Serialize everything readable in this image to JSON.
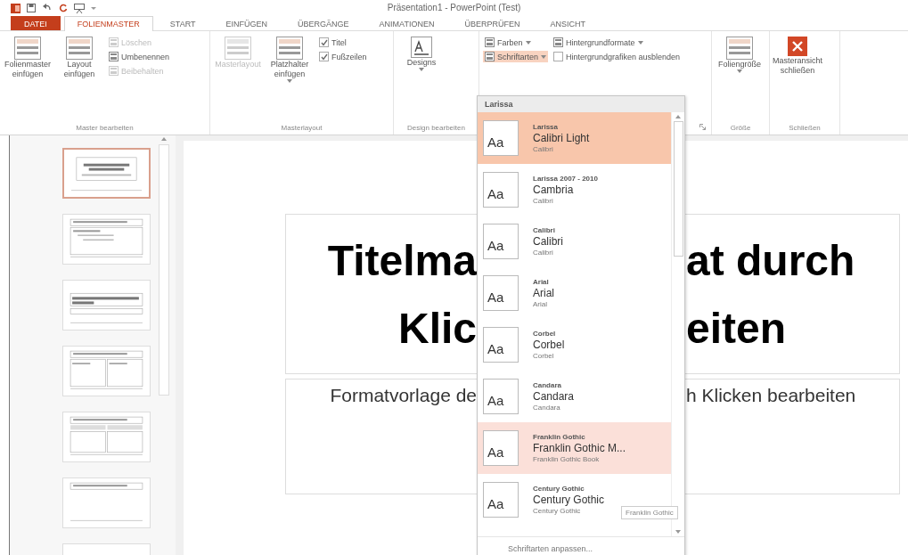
{
  "window": {
    "title": "Präsentation1 - PowerPoint (Test)"
  },
  "tabs": [
    {
      "label": "DATEI",
      "kind": "file",
      "selected": false
    },
    {
      "label": "FOLIENMASTER",
      "kind": "tab",
      "selected": true
    },
    {
      "label": "START",
      "kind": "tab",
      "selected": false
    },
    {
      "label": "EINFÜGEN",
      "kind": "tab",
      "selected": false
    },
    {
      "label": "ÜBERGÄNGE",
      "kind": "tab",
      "selected": false
    },
    {
      "label": "ANIMATIONEN",
      "kind": "tab",
      "selected": false
    },
    {
      "label": "ÜBERPRÜFEN",
      "kind": "tab",
      "selected": false
    },
    {
      "label": "ANSICHT",
      "kind": "tab",
      "selected": false
    }
  ],
  "ribbon": {
    "groups": [
      {
        "label": "Master bearbeiten",
        "items": [
          {
            "kind": "large",
            "label": "Folienmaster einfügen",
            "disabled": false,
            "dropdown": false
          },
          {
            "kind": "large",
            "label": "Layout einfügen",
            "disabled": false,
            "dropdown": false
          },
          {
            "kind": "stack",
            "items": [
              {
                "kind": "small",
                "label": "Löschen",
                "disabled": true,
                "dropdown": false
              },
              {
                "kind": "small",
                "label": "Umbenennen",
                "disabled": false,
                "dropdown": false
              },
              {
                "kind": "small",
                "label": "Beibehalten",
                "disabled": true,
                "dropdown": false
              }
            ]
          }
        ]
      },
      {
        "label": "Masterlayout",
        "items": [
          {
            "kind": "large",
            "label": "Masterlayout",
            "disabled": true,
            "dropdown": false
          },
          {
            "kind": "large",
            "label": "Platzhalter einfügen",
            "disabled": false,
            "dropdown": true
          },
          {
            "kind": "stack",
            "items": [
              {
                "kind": "check",
                "label": "Titel",
                "checked": true
              },
              {
                "kind": "check",
                "label": "Fußzeilen",
                "checked": true
              }
            ]
          }
        ]
      },
      {
        "label": "Design bearbeiten",
        "items": [
          {
            "kind": "theme",
            "label": "Designs",
            "disabled": false,
            "dropdown": true
          }
        ]
      },
      {
        "launcher": true,
        "items": [
          {
            "kind": "stack",
            "items": [
              {
                "kind": "small",
                "label": "Farben",
                "disabled": false,
                "dropdown": true,
                "open": false
              },
              {
                "kind": "small",
                "label": "Schriftarten",
                "disabled": false,
                "dropdown": true,
                "open": true
              }
            ]
          },
          {
            "kind": "stack",
            "items": [
              {
                "kind": "small",
                "label": "Hintergrundformate",
                "disabled": false,
                "dropdown": true,
                "open": false
              },
              {
                "kind": "check",
                "label": "Hintergrundgrafiken ausblenden",
                "checked": false
              }
            ]
          }
        ]
      },
      {
        "label": "Größe",
        "items": [
          {
            "kind": "large",
            "label": "Foliengröße",
            "disabled": false,
            "dropdown": true
          }
        ]
      },
      {
        "label": "Schließen",
        "items": [
          {
            "kind": "close",
            "label": "Masteransicht schließen",
            "disabled": false,
            "dropdown": false
          }
        ]
      }
    ]
  },
  "thumbnails": [
    {
      "kind": "title",
      "selected": true
    },
    {
      "kind": "content",
      "selected": false
    },
    {
      "kind": "section",
      "selected": false
    },
    {
      "kind": "two",
      "selected": false
    },
    {
      "kind": "compare",
      "selected": false
    },
    {
      "kind": "title-only",
      "selected": false
    },
    {
      "kind": "blank",
      "selected": false
    }
  ],
  "slide": {
    "title_lines": [
      {
        "left": "Titelma",
        "right": "at durch"
      },
      {
        "left": "Klic",
        "right": "eiten"
      }
    ],
    "subtitle": {
      "left": "Formatvorlage de",
      "right": "h Klicken bearbeiten"
    }
  },
  "font_menu": {
    "header": "Larissa",
    "items": [
      {
        "name": "Larissa",
        "heading": "Calibri Light",
        "body": "Calibri",
        "preview": "Aa",
        "selected": true,
        "hovered": false
      },
      {
        "name": "Larissa 2007 - 2010",
        "heading": "Cambria",
        "body": "Calibri",
        "preview": "Aa",
        "selected": false,
        "hovered": false
      },
      {
        "name": "Calibri",
        "heading": "Calibri",
        "body": "Calibri",
        "preview": "Aa",
        "selected": false,
        "hovered": false
      },
      {
        "name": "Arial",
        "heading": "Arial",
        "body": "Arial",
        "preview": "Aa",
        "selected": false,
        "hovered": false
      },
      {
        "name": "Corbel",
        "heading": "Corbel",
        "body": "Corbel",
        "preview": "Aa",
        "selected": false,
        "hovered": false
      },
      {
        "name": "Candara",
        "heading": "Candara",
        "body": "Candara",
        "preview": "Aa",
        "selected": false,
        "hovered": false
      },
      {
        "name": "Franklin Gothic",
        "heading": "Franklin Gothic M...",
        "body": "Franklin Gothic Book",
        "preview": "Aa",
        "selected": false,
        "hovered": true
      },
      {
        "name": "Century Gothic",
        "heading": "Century Gothic",
        "body": "Century Gothic",
        "preview": "Aa",
        "selected": false,
        "hovered": false
      }
    ],
    "footer": "Schriftarten anpassen...",
    "tooltip": "Franklin Gothic"
  }
}
